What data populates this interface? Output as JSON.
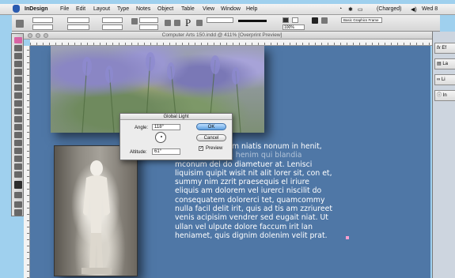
{
  "menubar": {
    "app": "InDesign",
    "items": [
      "File",
      "Edit",
      "Layout",
      "Type",
      "Notes",
      "Object",
      "Table",
      "View",
      "Window",
      "Help"
    ],
    "battery": "(Charged)",
    "clock": "Wed 8"
  },
  "control_bar": {
    "font_field": "Basic Graphics Frame",
    "stroke_weight": "1 pt",
    "zoom_value": "100%",
    "p_glyph": "P"
  },
  "document": {
    "title": "Computer Arts 150.indd @ 411% [Overprint Preview]"
  },
  "dialog": {
    "title": "Global Light",
    "angle_label": "Angle:",
    "angle_value": "118°",
    "altitude_label": "Altitude:",
    "altitude_value": "61°",
    "ok_label": "OK",
    "cancel_label": "Cancel",
    "preview_label": "Preview",
    "preview_checked": true
  },
  "body_text": {
    "lines": [
      "m niatis nonum in henit,",
      "lummoon henim qui blandia",
      "mconum del do diametuer at. Lenisci",
      "liquisim quipit wisit nit alit lorer sit, con et,",
      "summy nim zzrit praesequis el iriure",
      "eliquis am dolorem vel iurerci niscilit do",
      "consequatem dolorerci tet, quamcommy",
      "nulla facil delit irit, quis ad tis am zzriureet",
      "venis acipisim vendrer sed eugait niat. Ut",
      "ullan vel ulpute dolore faccum irit lan",
      "heniamet, quis dignim dolenim velit prat."
    ]
  },
  "panels": {
    "items": [
      "Ef",
      "La",
      "Li",
      "In"
    ]
  },
  "colors": {
    "page_blue": "#4f77a6",
    "ok_button": "#5d9fe0"
  }
}
